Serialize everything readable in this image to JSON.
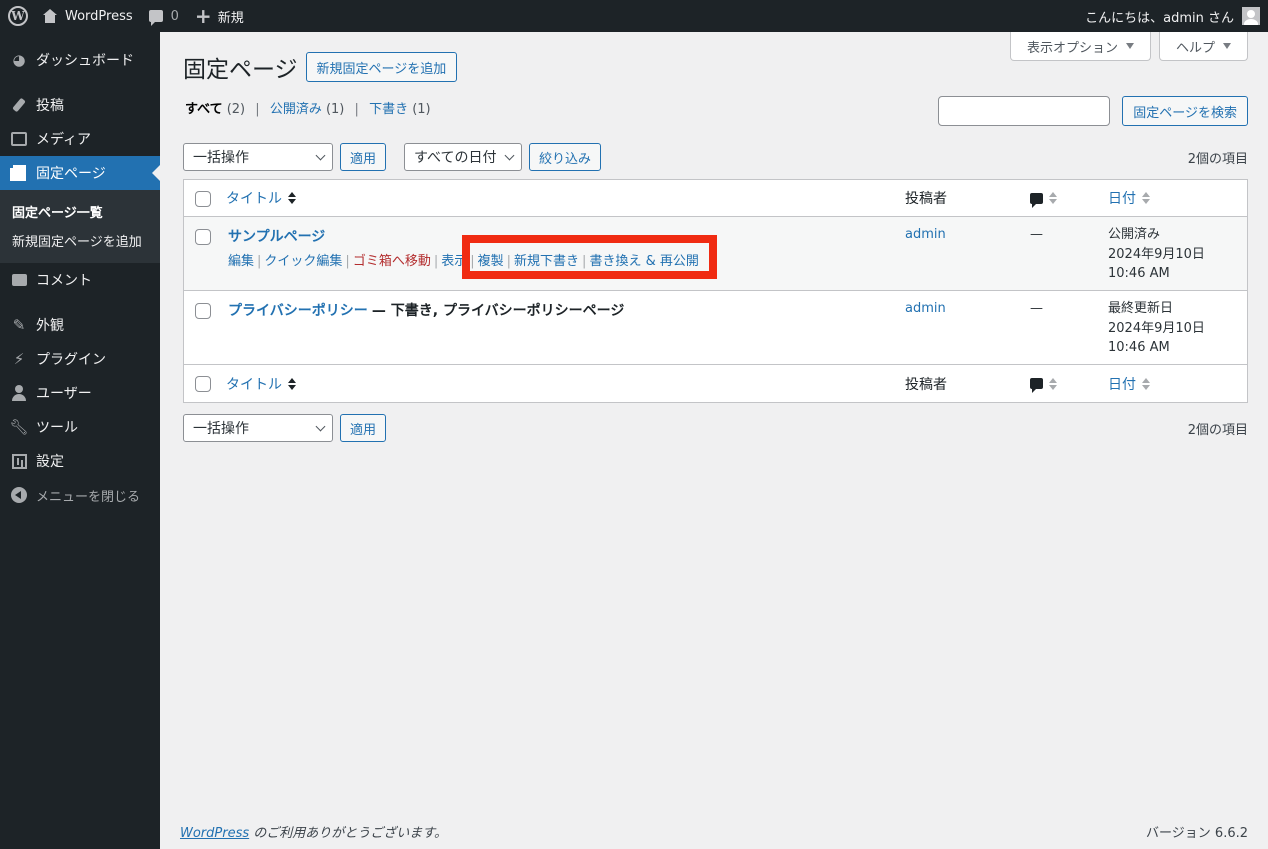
{
  "adminbar": {
    "site_name": "WordPress",
    "comments_count": "0",
    "new_label": "新規",
    "greeting": "こんにちは、admin さん"
  },
  "sidebar": {
    "items": [
      {
        "label": "ダッシュボード",
        "icon": "dashboard-icon"
      },
      {
        "label": "投稿",
        "icon": "pin-icon"
      },
      {
        "label": "メディア",
        "icon": "media-icon"
      },
      {
        "label": "固定ページ",
        "icon": "page-icon"
      },
      {
        "label": "コメント",
        "icon": "comment-icon"
      },
      {
        "label": "外観",
        "icon": "brush-icon"
      },
      {
        "label": "プラグイン",
        "icon": "plugin-icon"
      },
      {
        "label": "ユーザー",
        "icon": "user-icon"
      },
      {
        "label": "ツール",
        "icon": "wrench-icon"
      },
      {
        "label": "設定",
        "icon": "settings-icon"
      }
    ],
    "submenu": [
      "固定ページ一覧",
      "新規固定ページを追加"
    ],
    "collapse_label": "メニューを閉じる"
  },
  "screen_options": {
    "label": "表示オプション"
  },
  "help": {
    "label": "ヘルプ"
  },
  "page": {
    "title": "固定ページ",
    "add_new": "新規固定ページを追加"
  },
  "filters": {
    "all": "すべて",
    "all_count": "(2)",
    "published": "公開済み",
    "published_count": "(1)",
    "draft": "下書き",
    "draft_count": "(1)"
  },
  "search": {
    "button": "固定ページを検索",
    "value": ""
  },
  "tablenav": {
    "bulk_action": "一括操作",
    "apply": "適用",
    "date_filter": "すべての日付",
    "filter_button": "絞り込み",
    "items_count": "2個の項目"
  },
  "table": {
    "headers": {
      "title": "タイトル",
      "author": "投稿者",
      "date": "日付"
    },
    "rows": [
      {
        "title": "サンプルページ",
        "state": "",
        "author": "admin",
        "comments": "—",
        "date_status": "公開済み",
        "date": "2024年9月10日",
        "time": "10:46 AM",
        "actions": [
          "編集",
          "クイック編集",
          "ゴミ箱へ移動",
          "表示",
          "複製",
          "新規下書き",
          "書き換え & 再公開"
        ]
      },
      {
        "title": "プライバシーポリシー",
        "state": "— 下書き, プライバシーポリシーページ",
        "author": "admin",
        "comments": "—",
        "date_status": "最終更新日",
        "date": "2024年9月10日",
        "time": "10:46 AM"
      }
    ]
  },
  "footer": {
    "wp_link": "WordPress",
    "thanks": " のご利用ありがとうございます。",
    "version": "バージョン 6.6.2"
  },
  "highlight_color": "#f02b12",
  "accent_color": "#2271b1"
}
